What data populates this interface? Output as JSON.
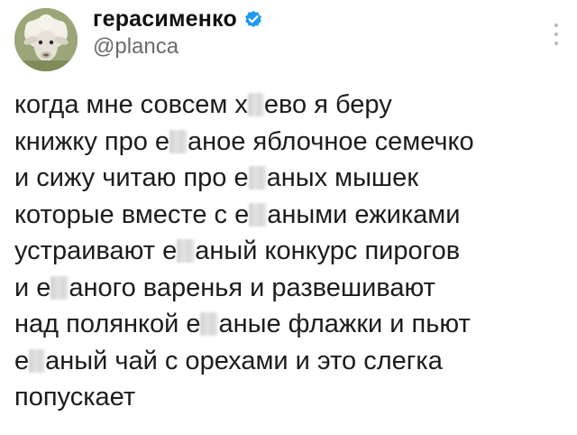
{
  "author": {
    "display_name": "герасименко",
    "handle": "@planca",
    "avatar": "sheep-avatar",
    "verified_icon": "verified-badge-icon",
    "verified_color": "#1d9bf0"
  },
  "menu_icon": "more-vertical-icon",
  "tweet": {
    "lines": [
      {
        "before": "когда мне совсем х",
        "after": "ево я беру"
      },
      {
        "before": "книжку про е",
        "after": "аное яблочное семечко"
      },
      {
        "before": "и сижу читаю про е",
        "after": "аных мышек"
      },
      {
        "before": "которые вместе с е",
        "after": "аными ежиками"
      },
      {
        "before": "устраивают е",
        "after": "аный конкурс пирогов"
      },
      {
        "before": "и е",
        "after": "аного варенья и развешивают"
      },
      {
        "before": "над полянкой е",
        "after": "аные флажки и пьют"
      },
      {
        "before": "е",
        "after": "аный чай с орехами и это слегка"
      },
      {
        "text": "попускает"
      }
    ]
  }
}
